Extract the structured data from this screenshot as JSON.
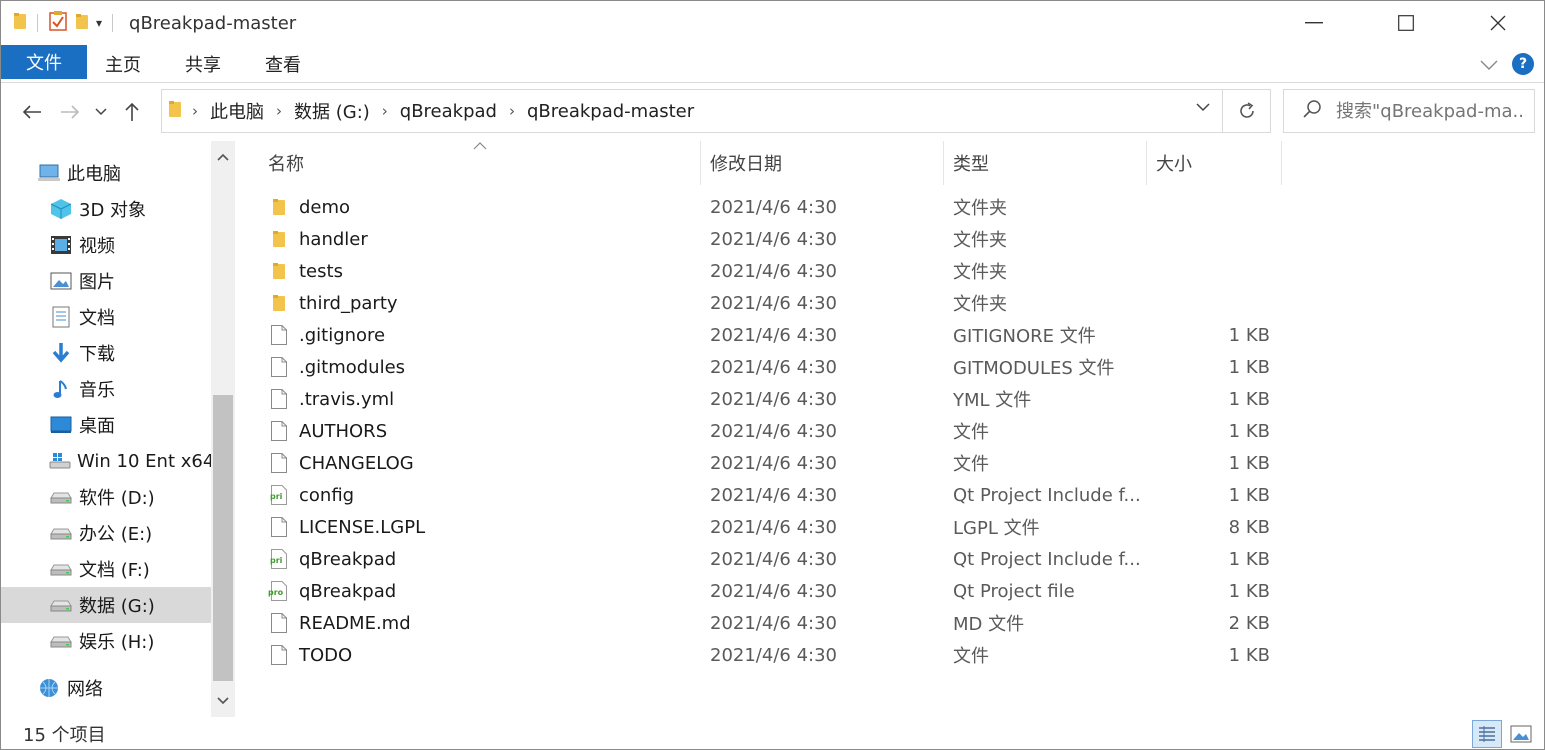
{
  "window": {
    "title": "qBreakpad-master",
    "controls": {
      "minimize": "—",
      "maximize": "☐",
      "close": "✕"
    }
  },
  "ribbon": {
    "tabs": [
      {
        "label": "文件"
      },
      {
        "label": "主页"
      },
      {
        "label": "共享"
      },
      {
        "label": "查看"
      }
    ],
    "help": "?"
  },
  "nav": {
    "back": "←",
    "forward": "→",
    "recent": "⌄",
    "up": "↑",
    "breadcrumb": [
      "此电脑",
      "数据 (G:)",
      "qBreakpad",
      "qBreakpad-master"
    ],
    "refresh": "↻",
    "search_placeholder": "搜索\"qBreakpad-ma..."
  },
  "tree": {
    "items": [
      {
        "label": "此电脑",
        "icon": "computer-icon",
        "indent": 0
      },
      {
        "label": "3D 对象",
        "icon": "3d-objects-icon",
        "indent": 1
      },
      {
        "label": "视频",
        "icon": "video-icon",
        "indent": 1
      },
      {
        "label": "图片",
        "icon": "pictures-icon",
        "indent": 1
      },
      {
        "label": "文档",
        "icon": "documents-icon",
        "indent": 1
      },
      {
        "label": "下载",
        "icon": "download-icon",
        "indent": 1
      },
      {
        "label": "音乐",
        "icon": "music-icon",
        "indent": 1
      },
      {
        "label": "桌面",
        "icon": "desktop-icon",
        "indent": 1
      },
      {
        "label": "Win 10 Ent x64",
        "icon": "windows-drive-icon",
        "indent": 1
      },
      {
        "label": "软件 (D:)",
        "icon": "drive-icon",
        "indent": 1
      },
      {
        "label": "办公 (E:)",
        "icon": "drive-icon",
        "indent": 1
      },
      {
        "label": "文档 (F:)",
        "icon": "drive-icon",
        "indent": 1
      },
      {
        "label": "数据 (G:)",
        "icon": "drive-icon",
        "indent": 1,
        "selected": true
      },
      {
        "label": "娱乐 (H:)",
        "icon": "drive-icon",
        "indent": 1
      },
      {
        "label": "网络",
        "icon": "network-icon",
        "indent": 0
      }
    ]
  },
  "columns": {
    "name": "名称",
    "modified": "修改日期",
    "type": "类型",
    "size": "大小"
  },
  "files": [
    {
      "name": "demo",
      "date": "2021/4/6 4:30",
      "type": "文件夹",
      "size": "",
      "icon": "folder"
    },
    {
      "name": "handler",
      "date": "2021/4/6 4:30",
      "type": "文件夹",
      "size": "",
      "icon": "folder"
    },
    {
      "name": "tests",
      "date": "2021/4/6 4:30",
      "type": "文件夹",
      "size": "",
      "icon": "folder"
    },
    {
      "name": "third_party",
      "date": "2021/4/6 4:30",
      "type": "文件夹",
      "size": "",
      "icon": "folder"
    },
    {
      "name": ".gitignore",
      "date": "2021/4/6 4:30",
      "type": "GITIGNORE 文件",
      "size": "1 KB",
      "icon": "file"
    },
    {
      "name": ".gitmodules",
      "date": "2021/4/6 4:30",
      "type": "GITMODULES 文件",
      "size": "1 KB",
      "icon": "file"
    },
    {
      "name": ".travis.yml",
      "date": "2021/4/6 4:30",
      "type": "YML 文件",
      "size": "1 KB",
      "icon": "file"
    },
    {
      "name": "AUTHORS",
      "date": "2021/4/6 4:30",
      "type": "文件",
      "size": "1 KB",
      "icon": "file"
    },
    {
      "name": "CHANGELOG",
      "date": "2021/4/6 4:30",
      "type": "文件",
      "size": "1 KB",
      "icon": "file"
    },
    {
      "name": "config",
      "date": "2021/4/6 4:30",
      "type": "Qt Project Include f...",
      "size": "1 KB",
      "icon": "pri"
    },
    {
      "name": "LICENSE.LGPL",
      "date": "2021/4/6 4:30",
      "type": "LGPL 文件",
      "size": "8 KB",
      "icon": "file"
    },
    {
      "name": "qBreakpad",
      "date": "2021/4/6 4:30",
      "type": "Qt Project Include f...",
      "size": "1 KB",
      "icon": "pri"
    },
    {
      "name": "qBreakpad",
      "date": "2021/4/6 4:30",
      "type": "Qt Project file",
      "size": "1 KB",
      "icon": "pro"
    },
    {
      "name": "README.md",
      "date": "2021/4/6 4:30",
      "type": "MD 文件",
      "size": "2 KB",
      "icon": "file"
    },
    {
      "name": "TODO",
      "date": "2021/4/6 4:30",
      "type": "文件",
      "size": "1 KB",
      "icon": "file"
    }
  ],
  "status": {
    "item_count": "15 个项目"
  },
  "colors": {
    "accent": "#1a6fc2",
    "folder": "#f3c44b",
    "selected": "#d9d9d9",
    "pri_green": "#3f9b2d"
  }
}
